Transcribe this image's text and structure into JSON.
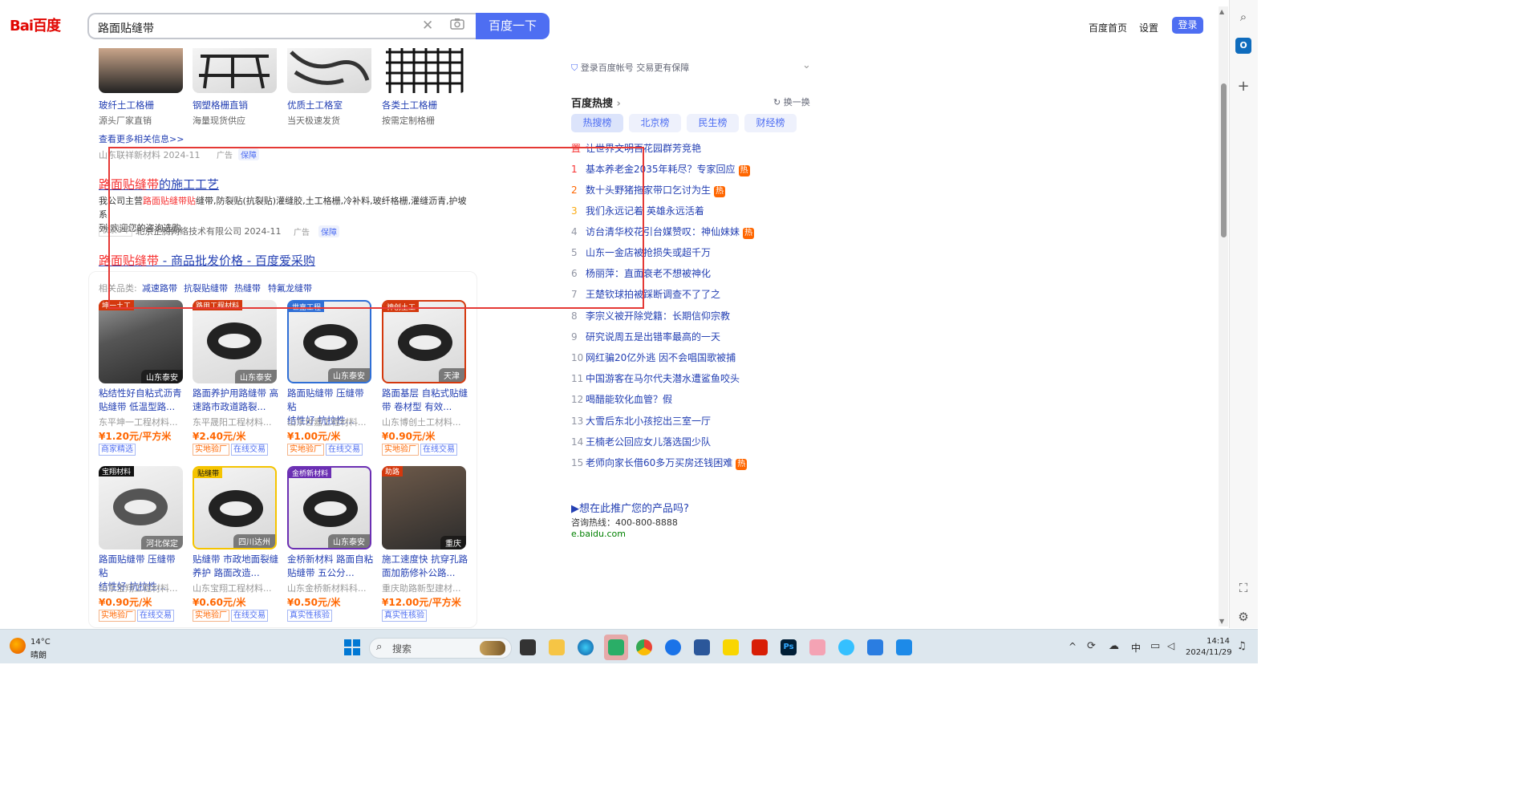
{
  "header": {
    "logo": "Bai百度",
    "query": "路面贴缝带",
    "search_button": "百度一下",
    "nav_home": "百度首页",
    "nav_settings": "设置",
    "login": "登录"
  },
  "top_products": [
    {
      "title": "玻纤土工格栅",
      "sub": "源头厂家直销"
    },
    {
      "title": "钢塑格栅直销",
      "sub": "海量现货供应"
    },
    {
      "title": "优质土工格室",
      "sub": "当天极速发货"
    },
    {
      "title": "各类土工格栅",
      "sub": "按需定制格栅"
    }
  ],
  "more_link": "查看更多相关信息>>",
  "ad1_source": "山东联祥新材料 2024-11",
  "ad_label": "广告",
  "bao_label": "保障",
  "result1": {
    "title_red": "路面贴缝带",
    "title_rest": "的施工工艺",
    "desc_a": "我公司主营",
    "desc_red": "路面贴缝带贴",
    "desc_b": "缝带,防裂贴(抗裂贴)灌缝胶,土工格栅,冷补料,玻纤格栅,灌缝沥青,护坡系",
    "desc_c": "列.欢迎您的咨询选购",
    "years": "收录8年",
    "source": "北京企腾网络技术有限公司 2024-11"
  },
  "result2": {
    "title_red": "路面贴缝带",
    "title_rest": " - 商品批发价格 - 百度爱采购",
    "related_label": "相关品类:",
    "related": [
      "减速路带",
      "抗裂贴缝带",
      "热缝带",
      "特氟龙缝带"
    ]
  },
  "products": [
    {
      "loc": "山东泰安",
      "tag": "坤一土工",
      "t1": "粘结性好自粘式沥青",
      "t2": "贴缝带 低温型路...",
      "shop": "东平坤一工程材料...",
      "price": "¥1.20元/平方米",
      "badges": [
        "商家精选"
      ]
    },
    {
      "loc": "山东泰安",
      "tag": "路用工程材料",
      "t1": "路面养护用路缝带 高",
      "t2": "速路市政道路裂...",
      "shop": "东平晟阳工程材料...",
      "price": "¥2.40元/米",
      "badges": [
        "实地验厂",
        "在线交易"
      ]
    },
    {
      "loc": "山东泰安",
      "tag": "世嘉工程",
      "t1": "路面贴缝带 压缝带 粘",
      "t2": "结性好 抗拉性...",
      "shop": "山东世嘉工程材料...",
      "price": "¥1.00元/米",
      "badges": [
        "实地验厂",
        "在线交易"
      ]
    },
    {
      "loc": "天津",
      "tag": "神创土工",
      "t1": "路面基层 自粘式贴缝",
      "t2": "带 卷材型 有效...",
      "shop": "山东博创土工材料...",
      "price": "¥0.90元/米",
      "badges": [
        "实地验厂",
        "在线交易"
      ]
    },
    {
      "loc": "河北保定",
      "tag": "宝翔材料",
      "t1": "路面贴缝带 压缝带 粘",
      "t2": "结性好 抗拉性...",
      "shop": "山东宝翔工程材料...",
      "price": "¥0.90元/米",
      "badges": [
        "实地验厂",
        "在线交易"
      ]
    },
    {
      "loc": "四川达州",
      "tag": "贴缝带",
      "t1": "贴缝带 市政地面裂缝",
      "t2": "养护 路面改造...",
      "shop": "山东宝翔工程材料...",
      "price": "¥0.60元/米",
      "badges": [
        "实地验厂",
        "在线交易"
      ]
    },
    {
      "loc": "山东泰安",
      "tag": "金桥新材料",
      "t1": "金桥新材料 路面自粘",
      "t2": "贴缝带 五公分...",
      "shop": "山东金桥新材料科...",
      "price": "¥0.50元/米",
      "badges": [
        "真实性核验"
      ]
    },
    {
      "loc": "重庆",
      "tag": "助路",
      "t1": "施工速度快 抗穿孔路",
      "t2": "面加筋修补公路...",
      "shop": "重庆助路新型建材...",
      "price": "¥12.00元/平方米",
      "badges": [
        "真实性核验"
      ]
    }
  ],
  "right": {
    "login_tip": "登录百度帐号 交易更有保障",
    "hot_title": "百度热搜",
    "refresh": "换一换",
    "tabs": [
      "热搜榜",
      "北京榜",
      "民生榜",
      "财经榜"
    ],
    "hot_items": [
      {
        "num": "置",
        "text": "让世界文明百花园群芳竞艳",
        "hot": false
      },
      {
        "num": "1",
        "text": "基本养老金2035年耗尽？专家回应",
        "hot": true
      },
      {
        "num": "2",
        "text": "数十头野猪拖家带口乞讨为生",
        "hot": true
      },
      {
        "num": "3",
        "text": "我们永远记着 英雄永远活着",
        "hot": false
      },
      {
        "num": "4",
        "text": "访台清华校花引台媒赞叹：神仙妹妹",
        "hot": true
      },
      {
        "num": "5",
        "text": "山东一金店被抢损失或超千万",
        "hot": false
      },
      {
        "num": "6",
        "text": "杨丽萍：直面衰老不想被神化",
        "hot": false
      },
      {
        "num": "7",
        "text": "王楚钦球拍被踩断调查不了了之",
        "hot": false
      },
      {
        "num": "8",
        "text": "李宗义被开除党籍：长期信仰宗教",
        "hot": false
      },
      {
        "num": "9",
        "text": "研究说周五是出错率最高的一天",
        "hot": false
      },
      {
        "num": "10",
        "text": "网红骗20亿外逃 因不会唱国歌被捕",
        "hot": false
      },
      {
        "num": "11",
        "text": "中国游客在马尔代夫潜水遭鲨鱼咬头",
        "hot": false
      },
      {
        "num": "12",
        "text": "喝醋能软化血管？假",
        "hot": false
      },
      {
        "num": "13",
        "text": "大雪后东北小孩挖出三室一厅",
        "hot": false
      },
      {
        "num": "14",
        "text": "王楠老公回应女儿落选国少队",
        "hot": false
      },
      {
        "num": "15",
        "text": "老师向家长借60多万买房还钱困难",
        "hot": true
      }
    ],
    "hot_mark": "热",
    "promo_title": "▶想在此推广您的产品吗?",
    "promo_phone": "咨询热线：400-800-8888",
    "promo_url": "e.baidu.com"
  },
  "taskbar": {
    "weather_temp": "14°C",
    "weather_desc": "晴朗",
    "search": "搜索",
    "ime": "中",
    "time": "14:14",
    "date": "2024/11/29"
  },
  "colors": {
    "brand": "#4e6ef2",
    "link": "#2440b3",
    "highlight": "#f73131",
    "price": "#ff6600",
    "annotation": "#e53935"
  }
}
